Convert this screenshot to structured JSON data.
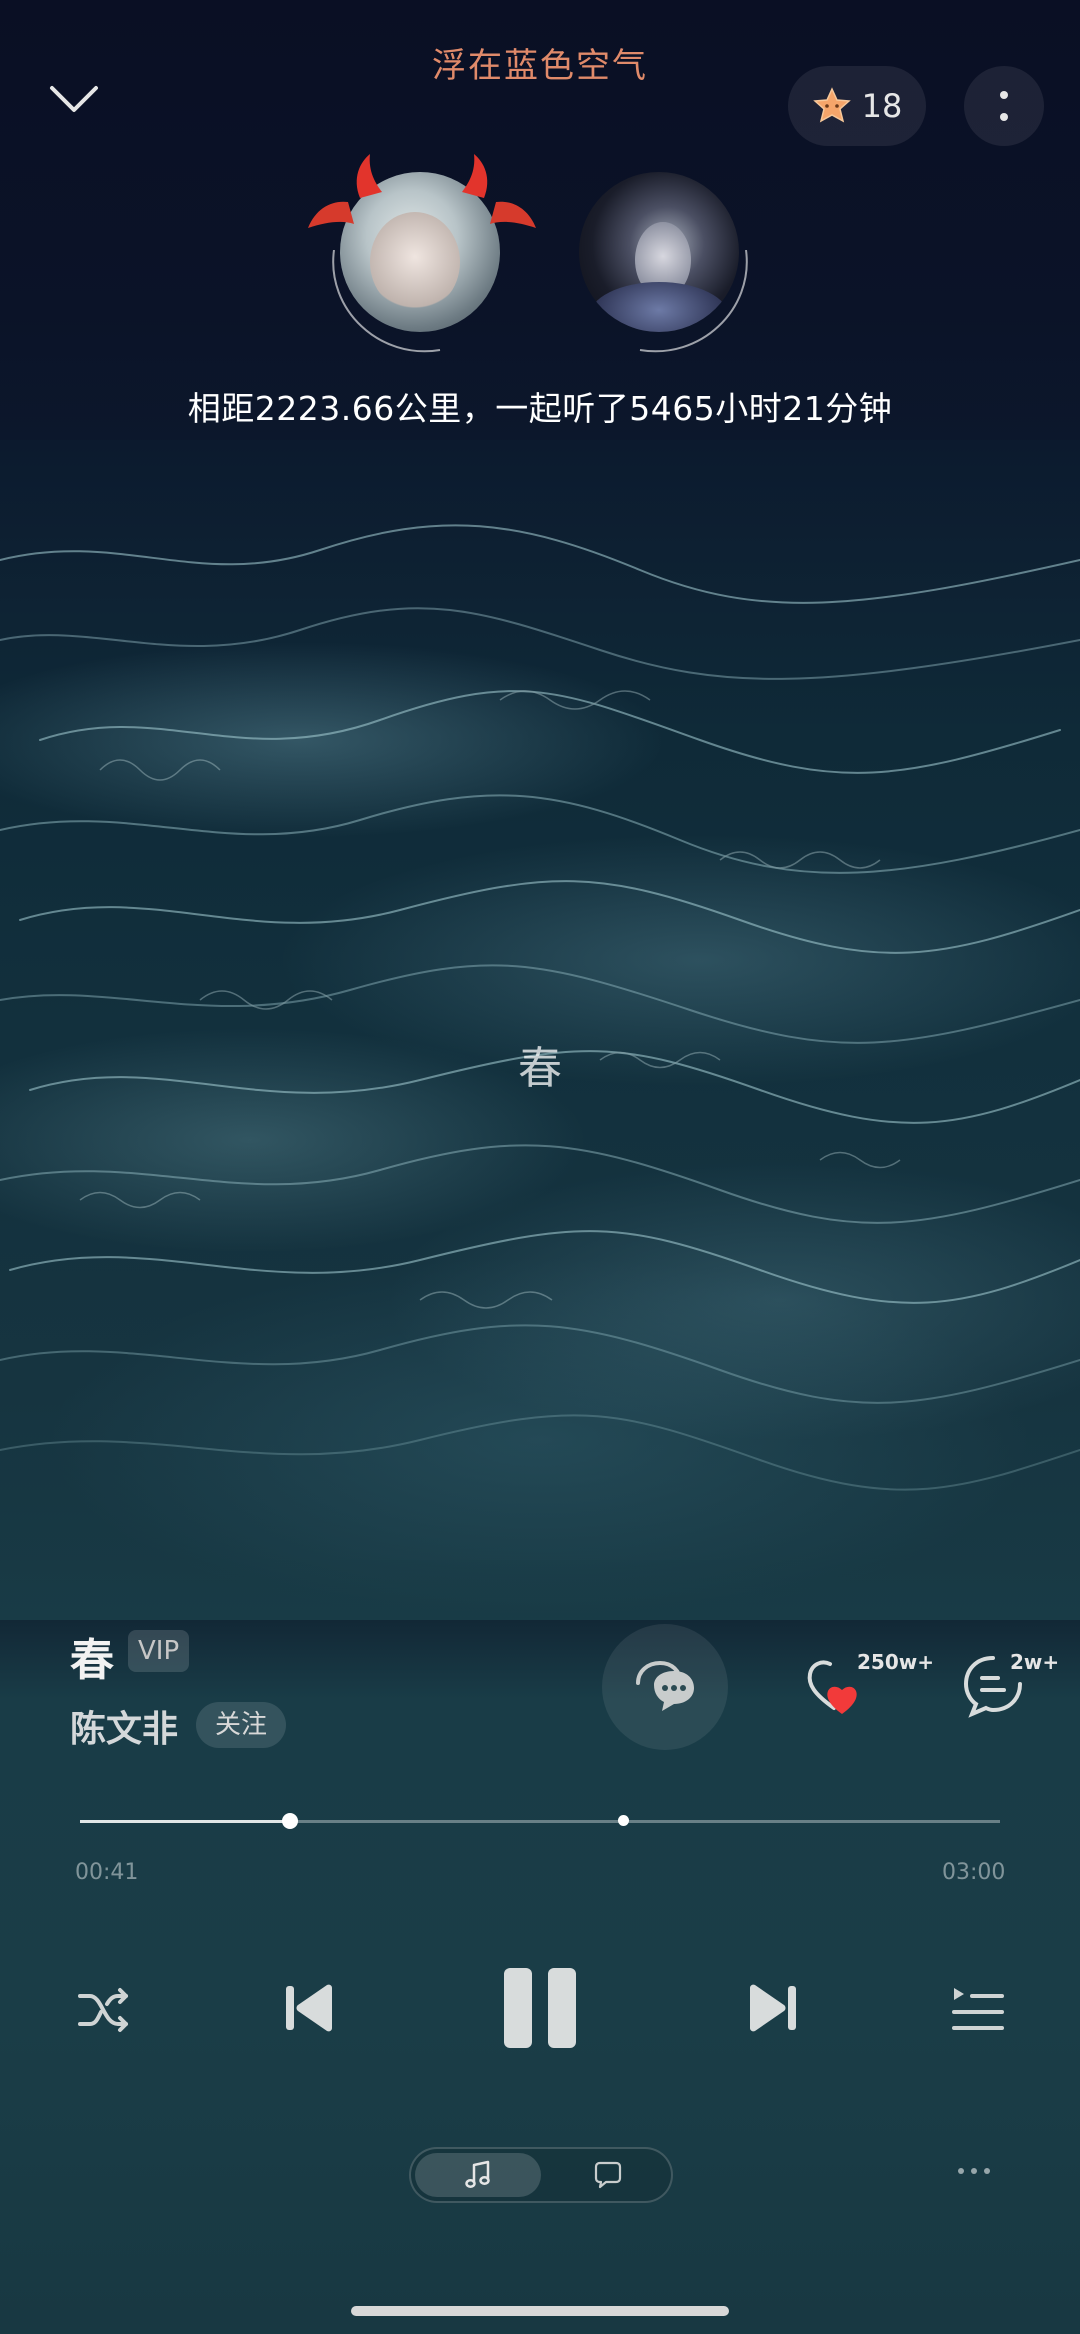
{
  "header": {
    "title": "浮在蓝色空气",
    "star_count": "18"
  },
  "duo": {
    "stats_text": "相距2223.66公里，一起听了5465小时21分钟"
  },
  "lyric": {
    "current_line": "春"
  },
  "song": {
    "title": "春",
    "vip_label": "VIP",
    "artist": "陈文非",
    "follow_label": "关注",
    "like_count": "250w+",
    "comment_count": "2w+"
  },
  "progress": {
    "current_time": "00:41",
    "total_time": "03:00",
    "played_fraction": 0.228,
    "marker_fraction": 0.59
  },
  "colors": {
    "title": "#e08a6a",
    "like_heart": "#f23a3a",
    "background": "#193c47"
  },
  "icons": {
    "collapse": "chevron-down-icon",
    "star": "star-icon",
    "more": "more-vertical-icon",
    "chat": "chat-bubbles-icon",
    "like": "heart-icon",
    "comment": "comment-icon",
    "shuffle": "shuffle-icon",
    "previous": "previous-icon",
    "pause": "pause-icon",
    "next": "next-icon",
    "playlist": "playlist-icon",
    "music_tab": "music-note-icon",
    "chat_tab": "chat-bubble-icon"
  }
}
